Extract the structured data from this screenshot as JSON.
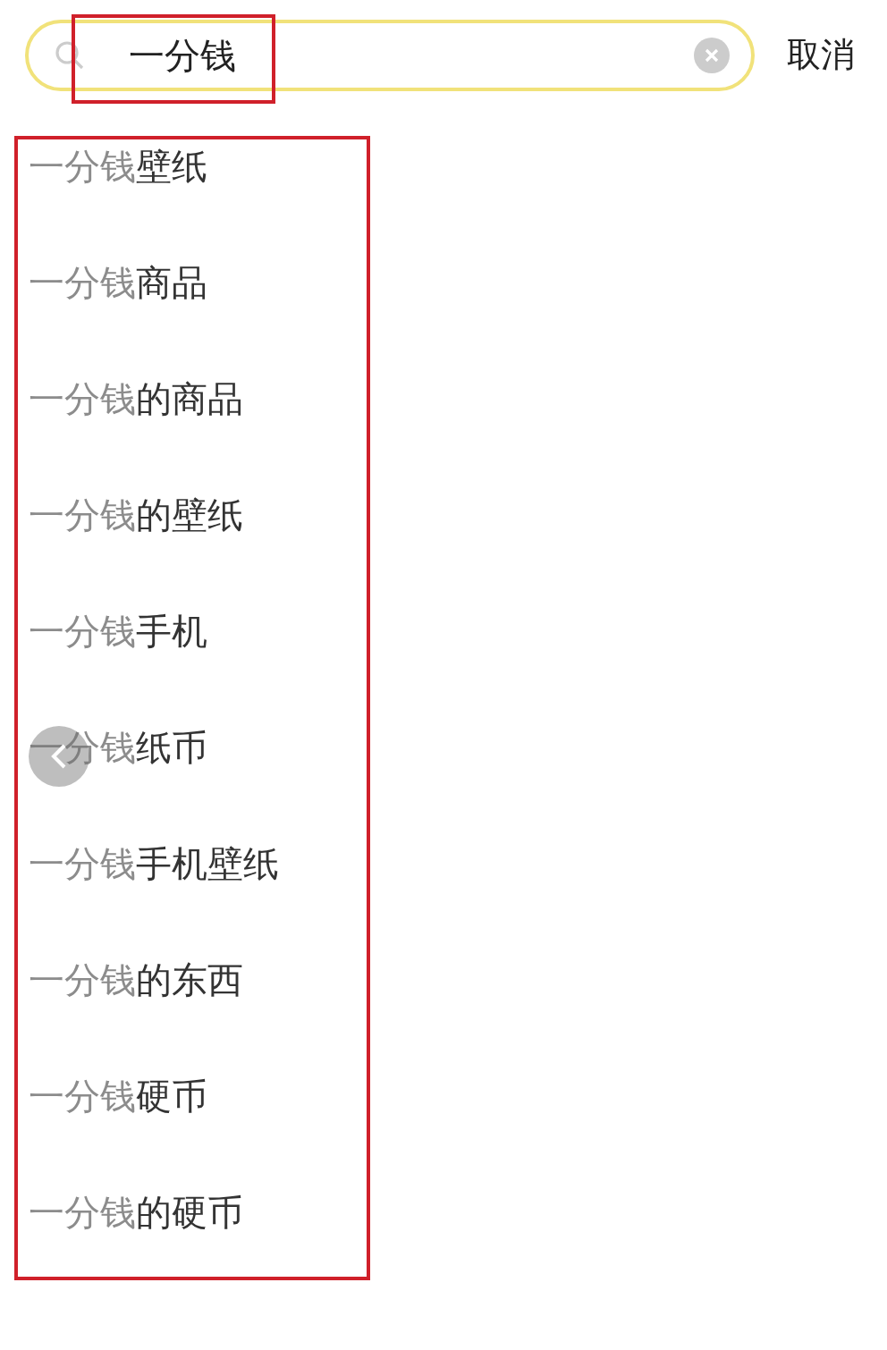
{
  "search": {
    "value": "一分钱",
    "cancel": "取消"
  },
  "suggestions": [
    {
      "match": "一分钱",
      "rest": "壁纸"
    },
    {
      "match": "一分钱",
      "rest": "商品"
    },
    {
      "match": "一分钱",
      "rest": "的商品"
    },
    {
      "match": "一分钱",
      "rest": "的壁纸"
    },
    {
      "match": "一分钱",
      "rest": "手机"
    },
    {
      "match": "一分钱",
      "rest": "纸币"
    },
    {
      "match": "一分钱",
      "rest": "手机壁纸"
    },
    {
      "match": "一分钱",
      "rest": "的东西"
    },
    {
      "match": "一分钱",
      "rest": "硬币"
    },
    {
      "match": "一分钱",
      "rest": "的硬币"
    }
  ]
}
